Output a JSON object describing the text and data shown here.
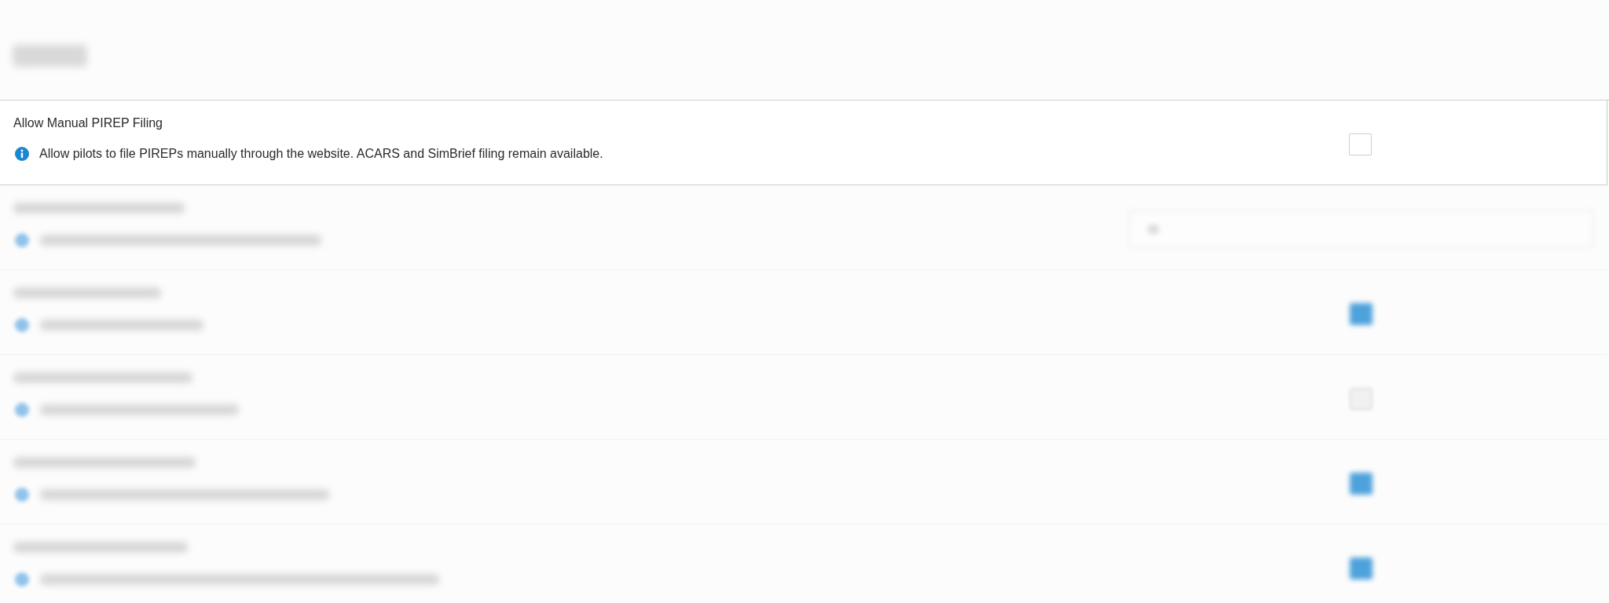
{
  "header": {
    "blurred": true
  },
  "settings": [
    {
      "kind": "checkbox",
      "blurred": false,
      "title": "Allow Manual PIREP Filing",
      "description": "Allow pilots to file PIREPs manually through the website. ACARS and SimBrief filing remain available.",
      "checked": false
    },
    {
      "kind": "input",
      "blurred": true
    },
    {
      "kind": "checkbox",
      "blurred": true,
      "checked": true
    },
    {
      "kind": "checkbox",
      "blurred": true,
      "checked": false
    },
    {
      "kind": "checkbox",
      "blurred": true,
      "checked": true
    },
    {
      "kind": "checkbox",
      "blurred": true,
      "checked": true
    }
  ]
}
